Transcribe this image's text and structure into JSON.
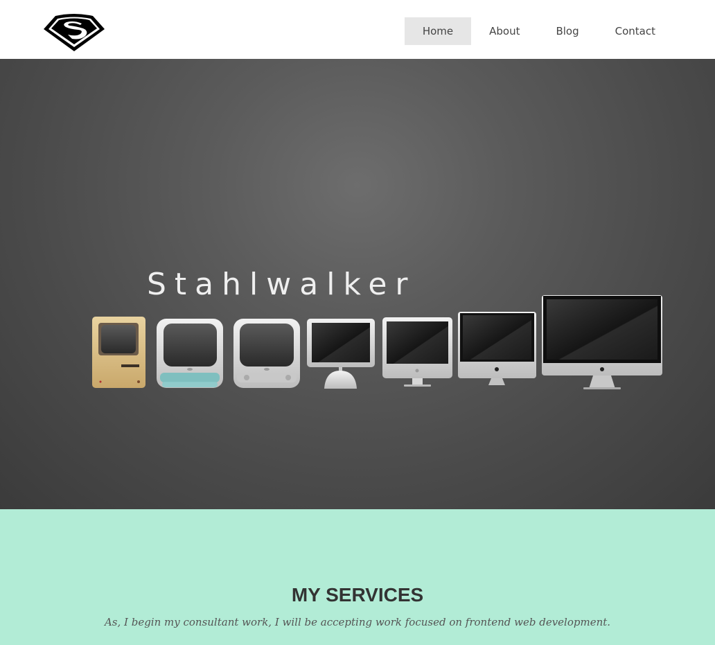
{
  "header": {
    "logo_icon": "superman-shield-icon",
    "nav": [
      {
        "label": "Home",
        "active": true
      },
      {
        "label": "About",
        "active": false
      },
      {
        "label": "Blog",
        "active": false
      },
      {
        "label": "Contact",
        "active": false
      }
    ]
  },
  "hero": {
    "title": "Stahlwalker",
    "image_icon": "mac-evolution-illustration"
  },
  "services": {
    "title": "MY SERVICES",
    "subtitle": "As, I begin my consultant work, I will be accepting work focused on frontend web development."
  },
  "colors": {
    "services_bg": "#b2ecd6",
    "hero_bg": "#5b5b5b",
    "nav_active_bg": "#e6e6e6"
  }
}
